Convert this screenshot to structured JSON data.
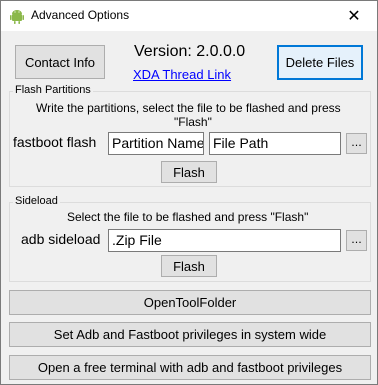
{
  "window": {
    "title": "Advanced Options",
    "close_glyph": "✕",
    "icon": "android-icon"
  },
  "header": {
    "contact_label": "Contact Info",
    "version_text": "Version: 2.0.0.0",
    "xda_link": "XDA Thread Link",
    "delete_label": "Delete Files"
  },
  "flash": {
    "group_title": "Flash Partitions",
    "instruction_line1": "Write the partitions, select the file to be flashed and press",
    "instruction_line2": "\"Flash\"",
    "row_label": "fastboot flash",
    "partition_value": "Partition Name",
    "file_value": "File Path",
    "browse_label": "...",
    "flash_label": "Flash"
  },
  "sideload": {
    "group_title": "Sideload",
    "instruction": "Select the file to be flashed and press \"Flash\"",
    "row_label": "adb sideload",
    "zip_value": ".Zip File",
    "browse_label": "...",
    "flash_label": "Flash"
  },
  "buttons": {
    "open_tool_folder": "OpenToolFolder",
    "set_privileges": "Set Adb and Fastboot privileges in system wide",
    "open_terminal": "Open a free terminal with adb and fastboot privileges"
  }
}
